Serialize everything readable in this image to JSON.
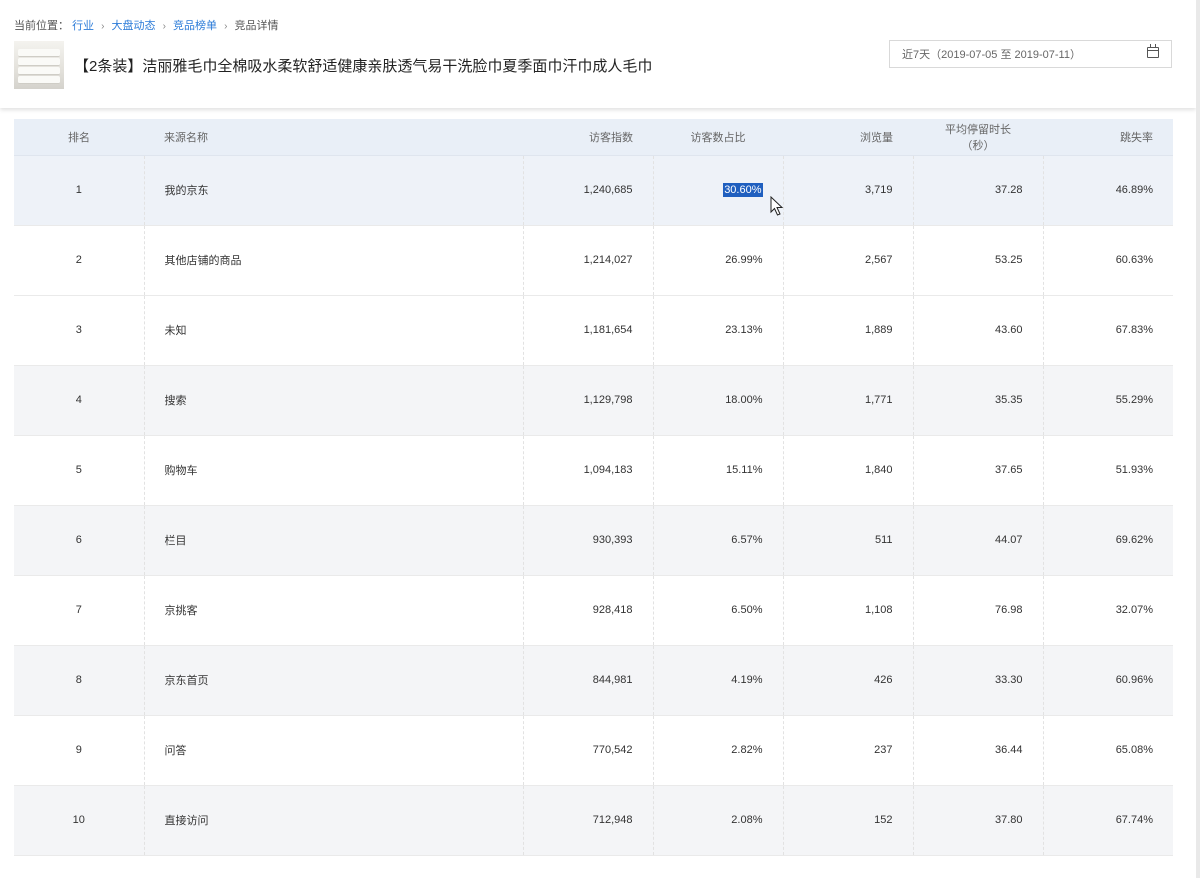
{
  "breadcrumb": {
    "prefix": "当前位置：",
    "items": [
      {
        "label": "行业",
        "link": true
      },
      {
        "label": "大盘动态",
        "link": true
      },
      {
        "label": "竞品榜单",
        "link": true
      },
      {
        "label": "竞品详情",
        "link": false
      }
    ],
    "separator": "›"
  },
  "product": {
    "title": "【2条装】洁丽雅毛巾全棉吸水柔软舒适健康亲肤透气易干洗脸巾夏季面巾汗巾成人毛巾",
    "thumbnail_icon": "towel-stack-thumbnail"
  },
  "date_range": {
    "label": "近7天（2019-07-05 至 2019-07-11）",
    "icon": "calendar-icon"
  },
  "table": {
    "headers": [
      "排名",
      "来源名称",
      "访客指数",
      "访客数占比",
      "浏览量",
      "平均停留时长（秒）",
      "跳失率"
    ],
    "rows": [
      {
        "rank": "1",
        "source": "我的京东",
        "visitor_index": "1,240,685",
        "visitor_share": "30.60%",
        "page_views": "3,719",
        "avg_stay": "37.28",
        "bounce_rate": "46.89%"
      },
      {
        "rank": "2",
        "source": "其他店铺的商品",
        "visitor_index": "1,214,027",
        "visitor_share": "26.99%",
        "page_views": "2,567",
        "avg_stay": "53.25",
        "bounce_rate": "60.63%"
      },
      {
        "rank": "3",
        "source": "未知",
        "visitor_index": "1,181,654",
        "visitor_share": "23.13%",
        "page_views": "1,889",
        "avg_stay": "43.60",
        "bounce_rate": "67.83%"
      },
      {
        "rank": "4",
        "source": "搜索",
        "visitor_index": "1,129,798",
        "visitor_share": "18.00%",
        "page_views": "1,771",
        "avg_stay": "35.35",
        "bounce_rate": "55.29%"
      },
      {
        "rank": "5",
        "source": "购物车",
        "visitor_index": "1,094,183",
        "visitor_share": "15.11%",
        "page_views": "1,840",
        "avg_stay": "37.65",
        "bounce_rate": "51.93%"
      },
      {
        "rank": "6",
        "source": "栏目",
        "visitor_index": "930,393",
        "visitor_share": "6.57%",
        "page_views": "511",
        "avg_stay": "44.07",
        "bounce_rate": "69.62%"
      },
      {
        "rank": "7",
        "source": "京挑客",
        "visitor_index": "928,418",
        "visitor_share": "6.50%",
        "page_views": "1,108",
        "avg_stay": "76.98",
        "bounce_rate": "32.07%"
      },
      {
        "rank": "8",
        "source": "京东首页",
        "visitor_index": "844,981",
        "visitor_share": "4.19%",
        "page_views": "426",
        "avg_stay": "33.30",
        "bounce_rate": "60.96%"
      },
      {
        "rank": "9",
        "source": "问答",
        "visitor_index": "770,542",
        "visitor_share": "2.82%",
        "page_views": "237",
        "avg_stay": "36.44",
        "bounce_rate": "65.08%"
      },
      {
        "rank": "10",
        "source": "直接访问",
        "visitor_index": "712,948",
        "visitor_share": "2.08%",
        "page_views": "152",
        "avg_stay": "37.80",
        "bounce_rate": "67.74%"
      }
    ]
  },
  "selection": {
    "row": 0,
    "column": "visitor_share",
    "highlight_color": "#1f5fbf"
  }
}
